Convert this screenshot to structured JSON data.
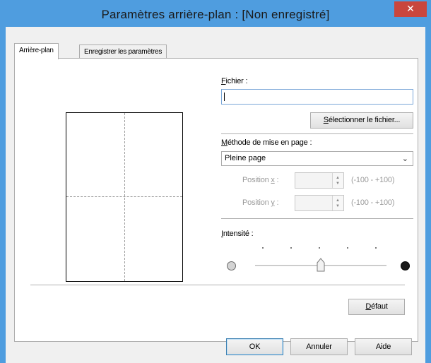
{
  "window": {
    "title": "Paramètres arrière-plan : [Non enregistré]",
    "close_glyph": "✕"
  },
  "tabs": [
    {
      "label": "Arrière-plan",
      "active": true
    },
    {
      "label": "Enregistrer les paramètres",
      "active": false
    }
  ],
  "file": {
    "label_first": "F",
    "label_rest": "ichier :",
    "value": "",
    "select_button_prefix": "",
    "select_button_accel": "S",
    "select_button_rest": "électionner le fichier..."
  },
  "layout": {
    "label_accel": "M",
    "label_rest": "éthode de mise en page :",
    "selected": "Pleine page",
    "position_x": {
      "label_prefix": "Position ",
      "accel": "x",
      "label_suffix": " :",
      "value": "",
      "range": "(-100 - +100)"
    },
    "position_y": {
      "label_prefix": "Position ",
      "accel": "y",
      "label_suffix": " :",
      "value": "",
      "range": "(-100 - +100)"
    }
  },
  "intensity": {
    "label_accel": "I",
    "label_rest": "ntensité :",
    "level_fraction": 0.5
  },
  "buttons": {
    "default_accel": "D",
    "default_rest": "éfaut",
    "ok": "OK",
    "cancel": "Annuler",
    "help": "Aide"
  },
  "colors": {
    "titlebar": "#4f9ddf",
    "close_button": "#c9463d",
    "dialog_background": "#f0f0f0"
  }
}
